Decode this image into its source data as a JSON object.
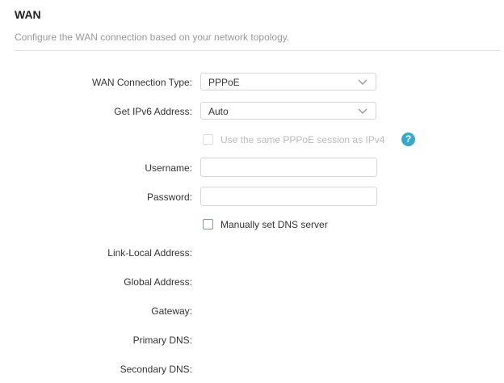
{
  "section": {
    "title": "WAN",
    "description": "Configure the WAN connection based on your network topology."
  },
  "form": {
    "wan_connection_type": {
      "label": "WAN Connection Type:",
      "value": "PPPoE"
    },
    "ipv6_address": {
      "label": "Get IPv6 Address:",
      "value": "Auto"
    },
    "same_session": {
      "label": "Use the same PPPoE session as IPv4",
      "checked": false,
      "disabled": true
    },
    "help_icon": "?",
    "username": {
      "label": "Username:",
      "value": ""
    },
    "password": {
      "label": "Password:",
      "value": ""
    },
    "manual_dns": {
      "label": "Manually set DNS server",
      "checked": false
    },
    "link_local_address": {
      "label": "Link-Local Address:",
      "value": ""
    },
    "global_address": {
      "label": "Global Address:",
      "value": ""
    },
    "gateway": {
      "label": "Gateway:",
      "value": ""
    },
    "primary_dns": {
      "label": "Primary DNS:",
      "value": ""
    },
    "secondary_dns": {
      "label": "Secondary DNS:",
      "value": ""
    }
  },
  "colors": {
    "accent": "#3aa8c9",
    "checkbox_border": "#5fa0cf",
    "muted_text": "#999999"
  }
}
